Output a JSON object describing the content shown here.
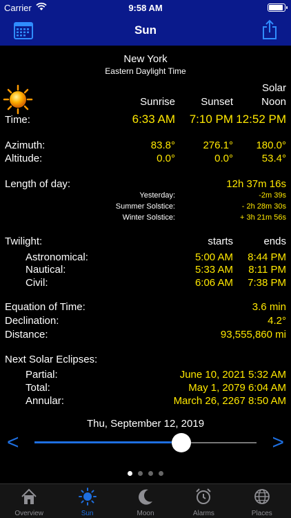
{
  "status": {
    "carrier": "Carrier",
    "time": "9:58 AM"
  },
  "nav": {
    "title": "Sun"
  },
  "location": {
    "city": "New York",
    "timezone": "Eastern Daylight Time"
  },
  "headers": {
    "sunrise": "Sunrise",
    "sunset": "Sunset",
    "solar": "Solar",
    "noon": "Noon"
  },
  "time": {
    "label": "Time:",
    "sunrise": "6:33 AM",
    "sunset": "7:10 PM",
    "noon": "12:52 PM"
  },
  "azimuth": {
    "label": "Azimuth:",
    "sunrise": "83.8°",
    "sunset": "276.1°",
    "noon": "180.0°"
  },
  "altitude": {
    "label": "Altitude:",
    "sunrise": "0.0°",
    "sunset": "0.0°",
    "noon": "53.4°"
  },
  "length": {
    "label": "Length of day:",
    "value": "12h 37m 16s",
    "yesterday_label": "Yesterday:",
    "yesterday": "-2m 39s",
    "summer_label": "Summer Solstice:",
    "summer": "- 2h 28m 30s",
    "winter_label": "Winter Solstice:",
    "winter": "+ 3h 21m 56s"
  },
  "twilight": {
    "label": "Twilight:",
    "starts": "starts",
    "ends": "ends",
    "astronomical_label": "Astronomical:",
    "astronomical_start": "5:00 AM",
    "astronomical_end": "8:44 PM",
    "nautical_label": "Nautical:",
    "nautical_start": "5:33 AM",
    "nautical_end": "8:11 PM",
    "civil_label": "Civil:",
    "civil_start": "6:06 AM",
    "civil_end": "7:38 PM"
  },
  "eot": {
    "label": "Equation of Time:",
    "value": "3.6 min"
  },
  "declination": {
    "label": "Declination:",
    "value": "4.2°"
  },
  "distance": {
    "label": "Distance:",
    "value": "93,555,860 mi"
  },
  "eclipses": {
    "label": "Next Solar Eclipses:",
    "partial_label": "Partial:",
    "partial": "June 10, 2021 5:32 AM",
    "total_label": "Total:",
    "total": "May 1, 2079 6:04 AM",
    "annular_label": "Annular:",
    "annular": "March 26, 2267 8:50 AM"
  },
  "date": {
    "value": "Thu, September 12, 2019",
    "prev": "<",
    "next": ">"
  },
  "slider": {
    "value": 0.66
  },
  "pager": {
    "count": 4,
    "active": 0
  },
  "tabs": [
    {
      "label": "Overview",
      "icon": "house-icon"
    },
    {
      "label": "Sun",
      "icon": "sun-icon"
    },
    {
      "label": "Moon",
      "icon": "moon-icon"
    },
    {
      "label": "Alarms",
      "icon": "alarm-clock-icon"
    },
    {
      "label": "Places",
      "icon": "globe-icon"
    }
  ],
  "colors": {
    "bar": "#0a1a8c",
    "value": "#ffe800",
    "accent": "#1e6fe0"
  }
}
